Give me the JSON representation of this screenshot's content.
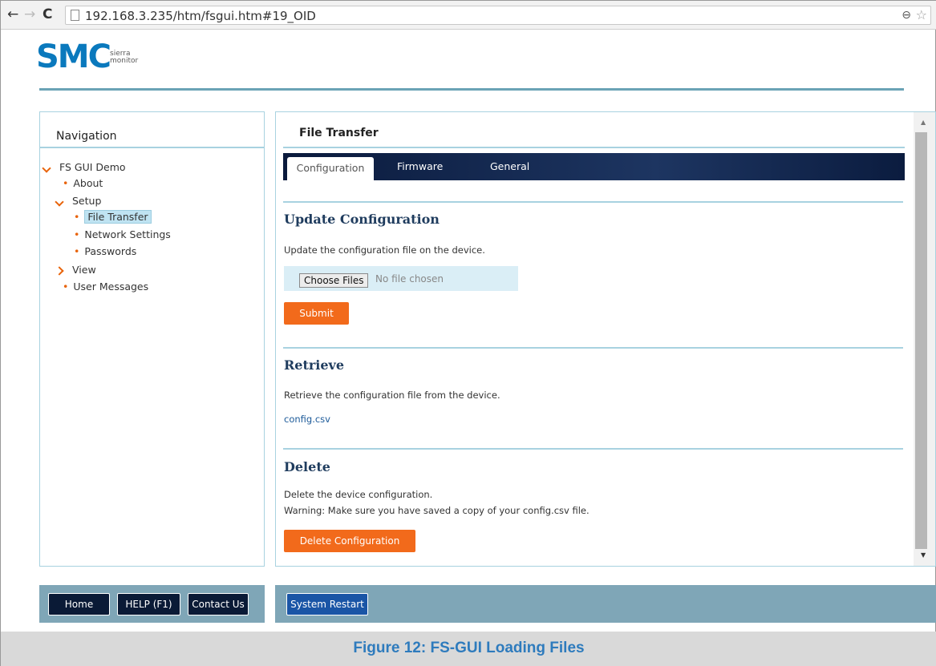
{
  "browser": {
    "url": "192.168.3.235/htm/fsgui.htm#19_OID",
    "back_icon": "←",
    "forward_icon": "→",
    "reload_icon": "C",
    "zoom_icon": "⊖",
    "star_icon": "☆"
  },
  "logo": {
    "main": "SMC",
    "sub_line1": "sierra",
    "sub_line2": "monitor",
    "color": "#0a79bd"
  },
  "navigation": {
    "title": "Navigation",
    "items": [
      {
        "label": "FS GUI Demo"
      },
      {
        "label": "About"
      },
      {
        "label": "Setup"
      },
      {
        "label": "File Transfer"
      },
      {
        "label": "Network Settings"
      },
      {
        "label": "Passwords"
      },
      {
        "label": "View"
      },
      {
        "label": "User Messages"
      }
    ]
  },
  "content": {
    "title": "File Transfer",
    "tabs": [
      {
        "label": "Configuration"
      },
      {
        "label": "Firmware"
      },
      {
        "label": "General"
      }
    ],
    "update": {
      "heading": "Update Configuration",
      "text": "Update the configuration file on the device.",
      "choose_label": "Choose Files",
      "no_file": "No file chosen",
      "submit_label": "Submit"
    },
    "retrieve": {
      "heading": "Retrieve",
      "text": "Retrieve the configuration file from the device.",
      "link": "config.csv"
    },
    "delete": {
      "heading": "Delete",
      "text1": "Delete the device configuration.",
      "text2": "Warning: Make sure you have saved a copy of your config.csv file.",
      "button_label": "Delete Configuration"
    }
  },
  "footer": {
    "home_label": "Home",
    "help_label": "HELP (F1)",
    "contact_label": "Contact Us",
    "restart_label": "System Restart"
  },
  "caption": "Figure 12: FS-GUI Loading Files",
  "colors": {
    "accent": "#f26a1b",
    "navy": "#0a1a36",
    "panel_border": "#a8d2e0",
    "footer": "#7fa6b7"
  }
}
